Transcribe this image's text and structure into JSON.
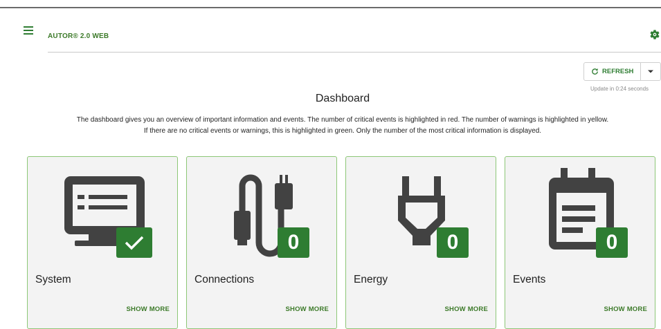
{
  "appbar": {
    "title": "AUTOR® 2.0 WEB"
  },
  "toolbar": {
    "refresh_label": "REFRESH",
    "update_text": "Update in 0:24 seconds"
  },
  "dashboard": {
    "title": "Dashboard",
    "description": "The dashboard gives you an overview of important information and events. The number of critical events is highlighted in red. The number of warnings is highlighted in yellow. If there are no critical events or warnings, this is highlighted in green. Only the number of the most critical information is displayed."
  },
  "cards": [
    {
      "label": "System",
      "badge": "",
      "status_icon": "check-icon",
      "more": "SHOW MORE"
    },
    {
      "label": "Connections",
      "badge": "0",
      "more": "SHOW MORE"
    },
    {
      "label": "Energy",
      "badge": "0",
      "more": "SHOW MORE"
    },
    {
      "label": "Events",
      "badge": "0",
      "more": "SHOW MORE"
    }
  ],
  "colors": {
    "accent": "#2e7d32",
    "card_border": "#8cc776",
    "icon": "#424242",
    "card_bg": "#f3f3f3"
  }
}
